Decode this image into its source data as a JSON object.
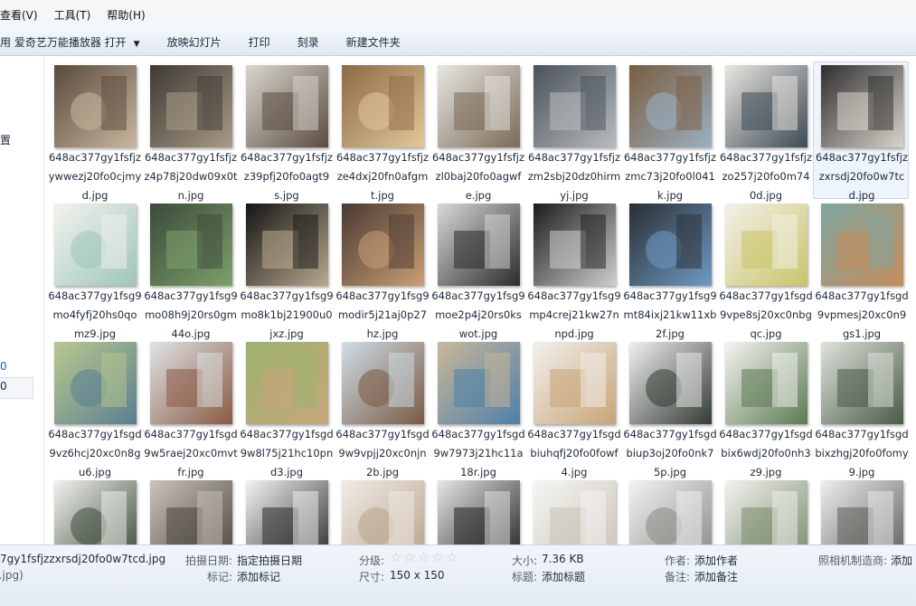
{
  "menu": {
    "items": [
      "查看(V)",
      "工具(T)",
      "帮助(H)"
    ]
  },
  "toolbar": {
    "open_with": "用 爱奇艺万能播放器 打开",
    "slideshow": "放映幻灯片",
    "print": "打印",
    "burn": "刻录",
    "new_folder": "新建文件夹"
  },
  "nav": {
    "partial_text": "置",
    "partial_blue1": "0",
    "partial_blue2": "0"
  },
  "files": [
    {
      "name": "648ac377gy1fsfjzywwezj20fo0cjmyd.jpg",
      "c1": "#5a4a3c",
      "c2": "#c9b79f",
      "selected": false
    },
    {
      "name": "648ac377gy1fsfjzz4p78j20dw09x0tn.jpg",
      "c1": "#3f3a35",
      "c2": "#a89a86",
      "selected": false
    },
    {
      "name": "648ac377gy1fsfjzz39pfj20fo0agt9s.jpg",
      "c1": "#d9d6cf",
      "c2": "#5b4d40",
      "selected": false
    },
    {
      "name": "648ac377gy1fsfjzze4dxj20fn0afgmt.jpg",
      "c1": "#8b6b45",
      "c2": "#e3c79a",
      "selected": false
    },
    {
      "name": "648ac377gy1fsfjzzl0baj20fo0agwfe.jpg",
      "c1": "#e8e6e1",
      "c2": "#7a6a58",
      "selected": false
    },
    {
      "name": "648ac377gy1fsfjzzm2sbj20dz0hirmyj.jpg",
      "c1": "#4a5258",
      "c2": "#b8bcbf",
      "selected": false
    },
    {
      "name": "648ac377gy1fsfjzzmc73j20fo0l041k.jpg",
      "c1": "#7a5c3e",
      "c2": "#9ab0c4",
      "selected": false
    },
    {
      "name": "648ac377gy1fsfjzzo257j20fo0m740d.jpg",
      "c1": "#eae6e0",
      "c2": "#3d4a55",
      "selected": false
    },
    {
      "name": "648ac377gy1fsfjzzxrsdj20fo0w7tcd.jpg",
      "c1": "#2e2e2e",
      "c2": "#d8d4cc",
      "selected": true
    },
    {
      "name": "648ac377gy1fsg9mo4fyfj20hs0qomz9.jpg",
      "c1": "#f4f2ee",
      "c2": "#9ec6b8",
      "selected": false
    },
    {
      "name": "648ac377gy1fsg9mo08h9j20rs0gm44o.jpg",
      "c1": "#3b4a3a",
      "c2": "#7da06c",
      "selected": false
    },
    {
      "name": "648ac377gy1fsg9mo8k1bj21900u0jxz.jpg",
      "c1": "#151515",
      "c2": "#b9a98e",
      "selected": false
    },
    {
      "name": "648ac377gy1fsg9modir5j21aj0p27hz.jpg",
      "c1": "#4a3a33",
      "c2": "#c99f74",
      "selected": false
    },
    {
      "name": "648ac377gy1fsg9moe2p4j20rs0kswot.jpg",
      "c1": "#d9d9d9",
      "c2": "#2b2b2b",
      "selected": false
    },
    {
      "name": "648ac377gy1fsg9mp4crej21kw27nnpd.jpg",
      "c1": "#1b1b1b",
      "c2": "#cfcfcf",
      "selected": false
    },
    {
      "name": "648ac377gy1fsg9mt84ixj21kw11xb2f.jpg",
      "c1": "#2a2e33",
      "c2": "#6f9ac4",
      "selected": false
    },
    {
      "name": "648ac377gy1fsgd9vpe8sj20xc0nbgqc.jpg",
      "c1": "#f3f1ea",
      "c2": "#c9c46a",
      "selected": false
    },
    {
      "name": "648ac377gy1fsgd9vpmesj20xc0n9gs1.jpg",
      "c1": "#7fa6a0",
      "c2": "#c48d5c",
      "selected": false
    },
    {
      "name": "648ac377gy1fsgd9vz6hcj20xc0n8gu6.jpg",
      "c1": "#b9c88f",
      "c2": "#5a7f91",
      "selected": false
    },
    {
      "name": "648ac377gy1fsgd9w5raej20xc0mvtfr.jpg",
      "c1": "#dfe3e6",
      "c2": "#8a5a44",
      "selected": false
    },
    {
      "name": "648ac377gy1fsgd9w8l75j21hc10pnd3.jpg",
      "c1": "#9bb36f",
      "c2": "#c9a67a",
      "selected": false
    },
    {
      "name": "648ac377gy1fsgd9w9vpjj20xc0njn2b.jpg",
      "c1": "#cfdde6",
      "c2": "#7a5a44",
      "selected": false
    },
    {
      "name": "648ac377gy1fsgd9w7973j21hc11a18r.jpg",
      "c1": "#c9b89a",
      "c2": "#4f7fa8",
      "selected": false
    },
    {
      "name": "648ac377gy1fsgdbiuhqfj20fo0fowf4.jpg",
      "c1": "#f2f0ec",
      "c2": "#c8a478",
      "selected": false
    },
    {
      "name": "648ac377gy1fsgdbiup3oj20fo0nk75p.jpg",
      "c1": "#f0f0f0",
      "c2": "#333a33",
      "selected": false
    },
    {
      "name": "648ac377gy1fsgdbix6wdj20fo0nh3z9.jpg",
      "c1": "#f5f5f3",
      "c2": "#5c7a52",
      "selected": false
    },
    {
      "name": "648ac377gy1fsgdbixzhgj20fo0fomy9.jpg",
      "c1": "#dfe3dd",
      "c2": "#4b5a48",
      "selected": false
    },
    {
      "name": "",
      "c1": "#f2f2f0",
      "c2": "#3c4a3a",
      "selected": false
    },
    {
      "name": "",
      "c1": "#c9c3b9",
      "c2": "#4b463f",
      "selected": false
    },
    {
      "name": "",
      "c1": "#f4f4f2",
      "c2": "#2c2c2c",
      "selected": false
    },
    {
      "name": "",
      "c1": "#f0ece6",
      "c2": "#b9a38b",
      "selected": false
    },
    {
      "name": "",
      "c1": "#e6e6e4",
      "c2": "#222222",
      "selected": false
    },
    {
      "name": "",
      "c1": "#f6f6f5",
      "c2": "#c9c2b6",
      "selected": false
    },
    {
      "name": "",
      "c1": "#f3f3f1",
      "c2": "#8a8a86",
      "selected": false
    },
    {
      "name": "",
      "c1": "#f2f2f0",
      "c2": "#7a8a6a",
      "selected": false
    },
    {
      "name": "",
      "c1": "#eeeeec",
      "c2": "#5d5d5a",
      "selected": false
    }
  ],
  "details": {
    "filename": "7gy1fsfjzzxrsdj20fo0w7tcd.jpg",
    "filetype": "(.jpg)",
    "date_taken_label": "拍摄日期:",
    "date_taken_value": "指定拍摄日期",
    "tags_label": "标记:",
    "tags_value": "添加标记",
    "rating_label": "分级:",
    "rating_value": 0,
    "dimensions_label": "尺寸:",
    "dimensions_value": "150 x 150",
    "size_label": "大小:",
    "size_value": "7.36 KB",
    "title_label": "标题:",
    "title_value": "添加标题",
    "author_label": "作者:",
    "author_value": "添加作者",
    "comments_label": "备注:",
    "comments_value": "添加备注",
    "camera_label": "照相机制造商:",
    "camera_value": "添加"
  }
}
